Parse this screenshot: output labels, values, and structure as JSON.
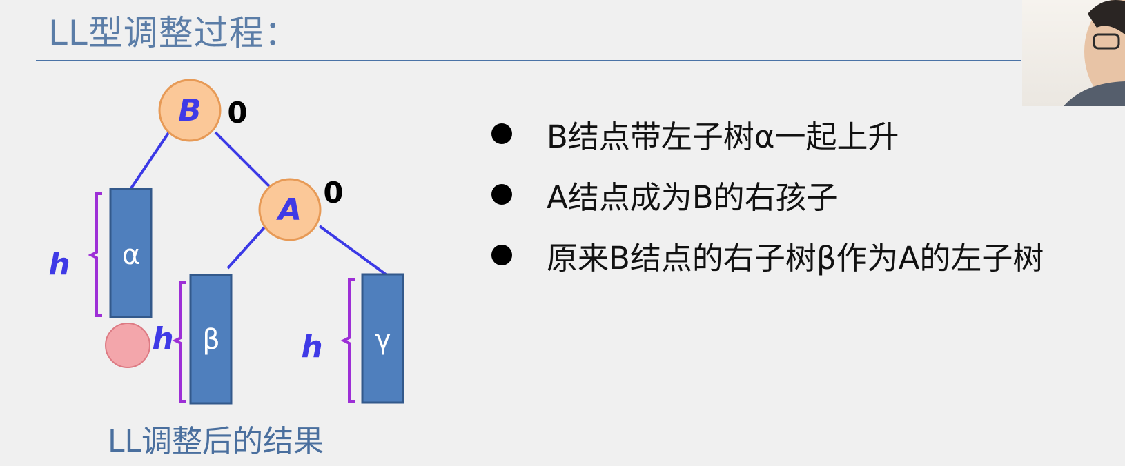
{
  "title": "LL型调整过程：",
  "diagram": {
    "root": {
      "label": "B",
      "balance": "0"
    },
    "child": {
      "label": "A",
      "balance": "0"
    },
    "subtrees": [
      {
        "label": "α",
        "height_label": "h"
      },
      {
        "label": "β",
        "height_label": "h"
      },
      {
        "label": "γ",
        "height_label": "h"
      }
    ],
    "caption": "LL调整后的结果"
  },
  "bullets": [
    "B结点带左子树α一起上升",
    "A结点成为B的右孩子",
    "原来B结点的右子树β作为A的左子树"
  ],
  "colors": {
    "title": "#5b7da7",
    "node_fill": "#fbc898",
    "node_stroke": "#e79a56",
    "node_label": "#3f3ae6",
    "edge": "#3b39e6",
    "subtree_fill": "#4f7fbd",
    "subtree_stroke": "#33598b",
    "brace": "#9d2fd6",
    "height_label": "#3f3ae6",
    "marker_fill": "#f3a6ab"
  }
}
